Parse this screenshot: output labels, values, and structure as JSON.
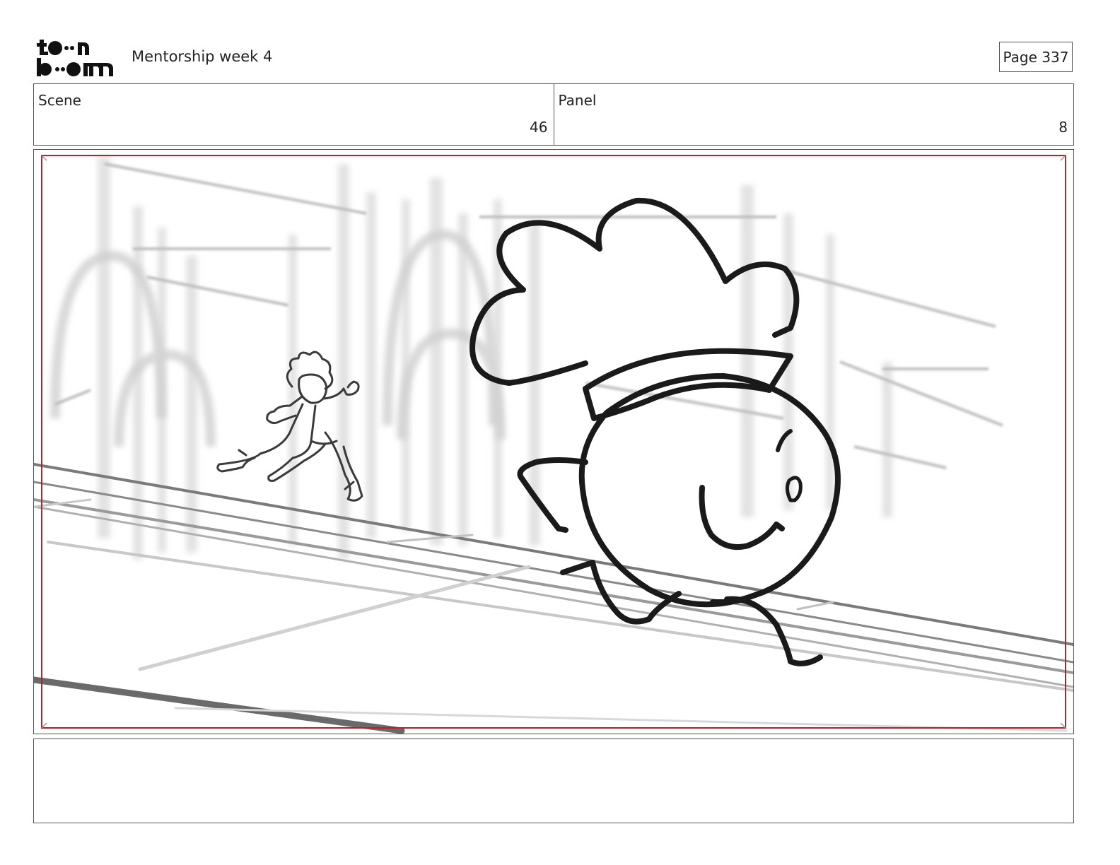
{
  "header": {
    "logo_alt": "toon boom",
    "doc_title": "Mentorship week 4",
    "page_label": "Page 337"
  },
  "info": {
    "scene_label": "Scene",
    "scene_value": "46",
    "panel_label": "Panel",
    "panel_value": "8"
  },
  "colors": {
    "safe_frame": "#b4232a",
    "ink": "#1a1a1a",
    "border": "#555555"
  },
  "notes": {
    "text": ""
  }
}
